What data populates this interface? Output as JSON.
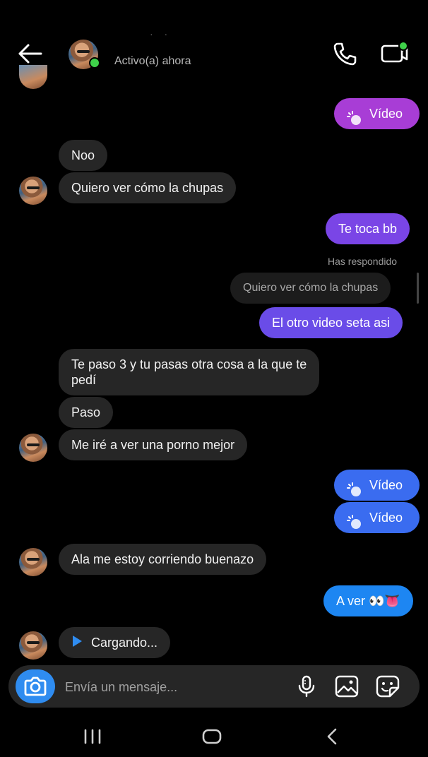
{
  "header": {
    "name": "· ·",
    "status": "Activo(a) ahora"
  },
  "messages": {
    "m1": "Vídeo",
    "m2": "Noo",
    "m3": "Quiero ver cómo la chupas",
    "m4": "Te toca bb",
    "replied_label": "Has respondido",
    "reply_quote": "Quiero ver cómo la chupas",
    "m5": "El otro video seta asi",
    "m6_line1": "Te paso 3 y tu pasas otra cosa a la que te",
    "m6_line2": "pedí",
    "m7": "Paso",
    "m8": "Me iré a ver una porno mejor",
    "m9": "Vídeo",
    "m10": "Vídeo",
    "m11": "Ala me estoy corriendo buenazo",
    "m12": "A ver 👀👅",
    "m13": "Cargando..."
  },
  "composer": {
    "placeholder": "Envía un mensaje..."
  },
  "colors": {
    "incoming": "#262626",
    "outgoing_magenta": "#a83dd6",
    "outgoing_purple": "#7a45e6",
    "outgoing_blue": "#3a6cf0",
    "outgoing_lightblue": "#1d86f2",
    "online": "#3fd14a"
  },
  "icons": [
    "back-arrow-icon",
    "phone-icon",
    "video-call-icon",
    "video-icon",
    "play-icon",
    "camera-icon",
    "microphone-icon",
    "gallery-icon",
    "sticker-icon",
    "nav-recent-icon",
    "nav-home-icon",
    "nav-back-icon"
  ]
}
